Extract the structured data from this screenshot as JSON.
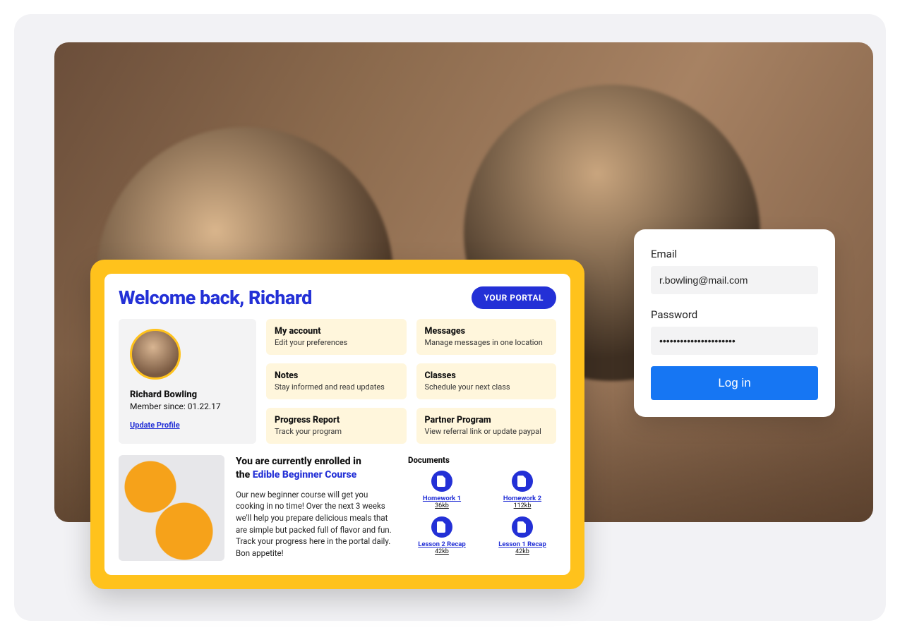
{
  "login": {
    "email_label": "Email",
    "email_value": "r.bowling@mail.com",
    "password_label": "Password",
    "password_value": "••••••••••••••••••••••",
    "button": "Log in"
  },
  "portal": {
    "title": "Welcome back, Richard",
    "badge": "YOUR PORTAL",
    "profile": {
      "name": "Richard Bowling",
      "member_since": "Member since: 01.22.17",
      "update_link": "Update Profile"
    },
    "tiles": [
      {
        "title": "My account",
        "sub": "Edit your preferences"
      },
      {
        "title": "Messages",
        "sub": "Manage messages in one location"
      },
      {
        "title": "Notes",
        "sub": "Stay informed and read updates"
      },
      {
        "title": "Classes",
        "sub": "Schedule your next class"
      },
      {
        "title": "Progress Report",
        "sub": "Track your program"
      },
      {
        "title": "Partner Program",
        "sub": "View referral link or update paypal"
      }
    ],
    "course": {
      "line1": "You are currently enrolled in",
      "line2_prefix": "the ",
      "line2_link": "Edible Beginner Course",
      "body": "Our new beginner course will get you cooking in no time! Over the next 3 weeks we'll help you prepare delicious meals that are simple but packed full of flavor and fun. Track your progress here in the portal daily. Bon appetite!"
    },
    "documents": {
      "heading": "Documents",
      "items": [
        {
          "name": "Homework 1",
          "size": "36kb"
        },
        {
          "name": "Homework 2",
          "size": "112kb"
        },
        {
          "name": "Lesson 2 Recap",
          "size": "42kb"
        },
        {
          "name": "Lesson 1 Recap",
          "size": "42kb"
        }
      ]
    }
  }
}
